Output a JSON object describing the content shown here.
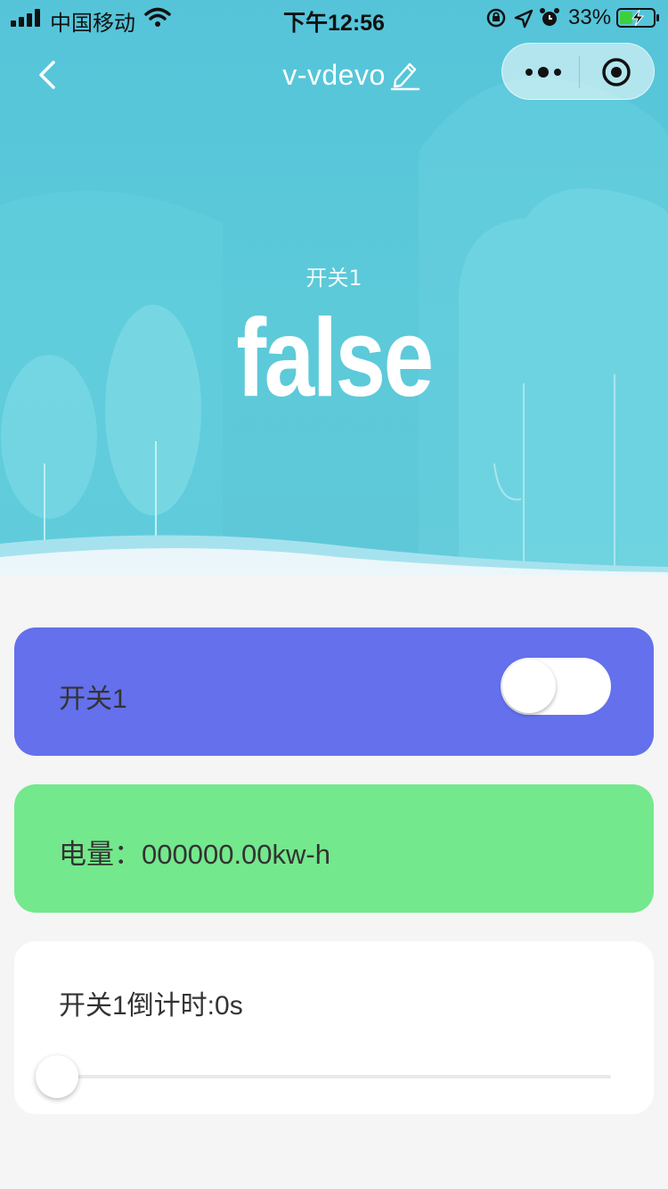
{
  "status_bar": {
    "carrier": "中国移动",
    "time": "下午12:56",
    "battery_percent": "33%",
    "icons": [
      "signal-icon",
      "wifi-icon",
      "orientation-lock-icon",
      "location-icon",
      "alarm-icon",
      "battery-charging-icon"
    ]
  },
  "nav": {
    "title": "v-vdevo",
    "icons": [
      "back-icon",
      "edit-icon",
      "more-icon",
      "target-icon"
    ]
  },
  "hero": {
    "label": "开关1",
    "value": "false"
  },
  "switch_card": {
    "label": "开关1",
    "toggle_on": false,
    "color": "#6470ec"
  },
  "energy_card": {
    "label": "电量：000000.00kw-h",
    "color": "#74e88c"
  },
  "timer_card": {
    "label": "开关1倒计时:0s",
    "slider_value": 0
  },
  "colors": {
    "hero_bg": "#5ccad9",
    "page_bg": "#f5f5f5"
  }
}
